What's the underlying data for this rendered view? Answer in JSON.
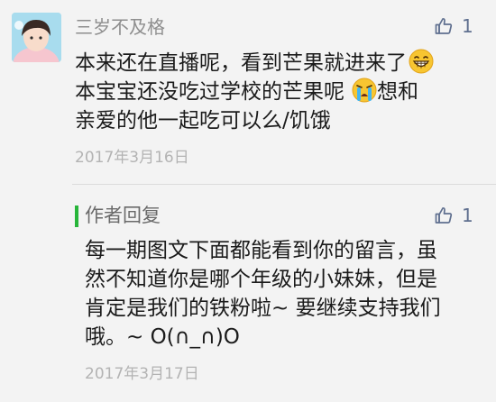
{
  "comment": {
    "username": "三岁不及格",
    "like_count": "1",
    "lines": [
      "本来还在直播呢，看到芒果就进来了",
      "本宝宝还没吃过学校的芒果呢",
      "想和",
      "亲爱的他一起吃可以么/饥饿"
    ],
    "date": "2017年3月16日",
    "emoji": [
      "grin-emoji",
      "crying-emoji"
    ]
  },
  "reply": {
    "title": "作者回复",
    "like_count": "1",
    "lines": [
      "每一期图文下面都能看到你的留言，虽",
      "然不知道你是哪个年级的小妹妹，但是",
      "肯定是我们的铁粉啦~ 要继续支持我们",
      "哦。~ O(∩_∩)O"
    ],
    "date": "2017年3月17日"
  },
  "colors": {
    "accent_green": "#27b53a",
    "like_blue": "#5f6f8f",
    "meta_gray": "#b3b3b3",
    "background": "#f3f3f3"
  }
}
